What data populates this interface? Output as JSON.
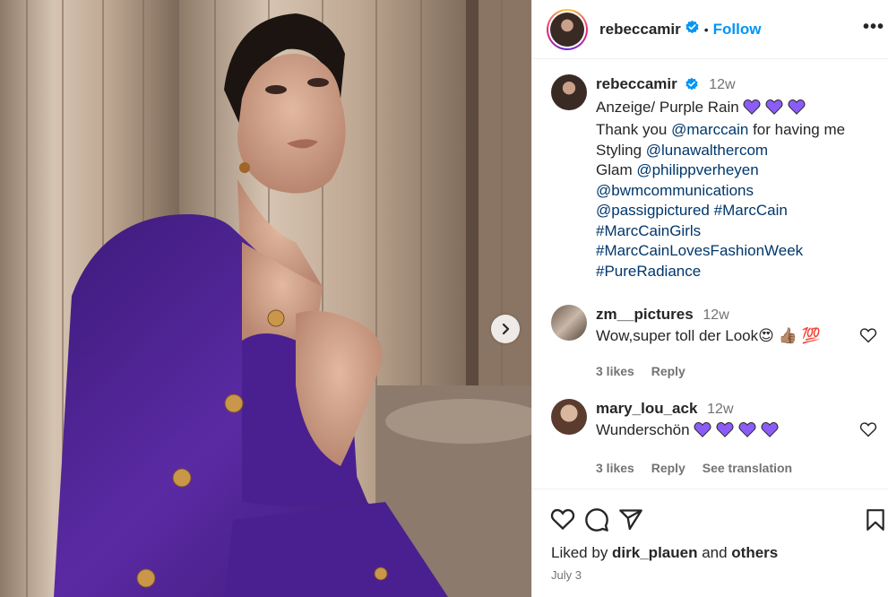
{
  "header": {
    "username": "rebeccamir",
    "separator": "•",
    "follow_label": "Follow",
    "more_label": "•••"
  },
  "caption": {
    "username": "rebeccamir",
    "time": "12w",
    "line1": "Anzeige/ Purple Rain",
    "line2_prefix": "Thank you ",
    "line2_link": "@marccain",
    "line2_suffix": " for having me",
    "line3_prefix": "Styling ",
    "line3_link": "@lunawalthercom",
    "line4_prefix": "Glam ",
    "line4_link": "@philippverheyen",
    "line5_link": "@bwmcommunications",
    "line6_link1": "@passigpictured",
    "line6_link2": "#MarcCain",
    "line7_link": "#MarcCainGirls",
    "line8_link": "#MarcCainLovesFashionWeek",
    "line9_link": "#PureRadiance"
  },
  "comments": [
    {
      "username": "zm__pictures",
      "time": "12w",
      "text": "Wow,super toll der Look",
      "emojis": "😍 👍🏽 💯",
      "likes": "3 likes",
      "reply": "Reply"
    },
    {
      "username": "mary_lou_ack",
      "time": "12w",
      "text": "Wunderschön",
      "likes": "3 likes",
      "reply": "Reply",
      "translate": "See translation"
    }
  ],
  "footer": {
    "liked_prefix": "Liked by ",
    "liked_user": "dirk_plauen",
    "liked_and": " and ",
    "liked_others": "others",
    "date": "July 3"
  },
  "colors": {
    "accent": "#0095f6",
    "link": "#00376b",
    "muted": "#737373",
    "heart_purple": "#8b5cf6",
    "suit_purple": "#4b1f8f"
  },
  "icons": [
    "verified-badge-icon",
    "more-options-icon",
    "chevron-right-icon",
    "heart-icon",
    "comment-icon",
    "share-icon",
    "bookmark-icon",
    "purple-heart-icon"
  ]
}
